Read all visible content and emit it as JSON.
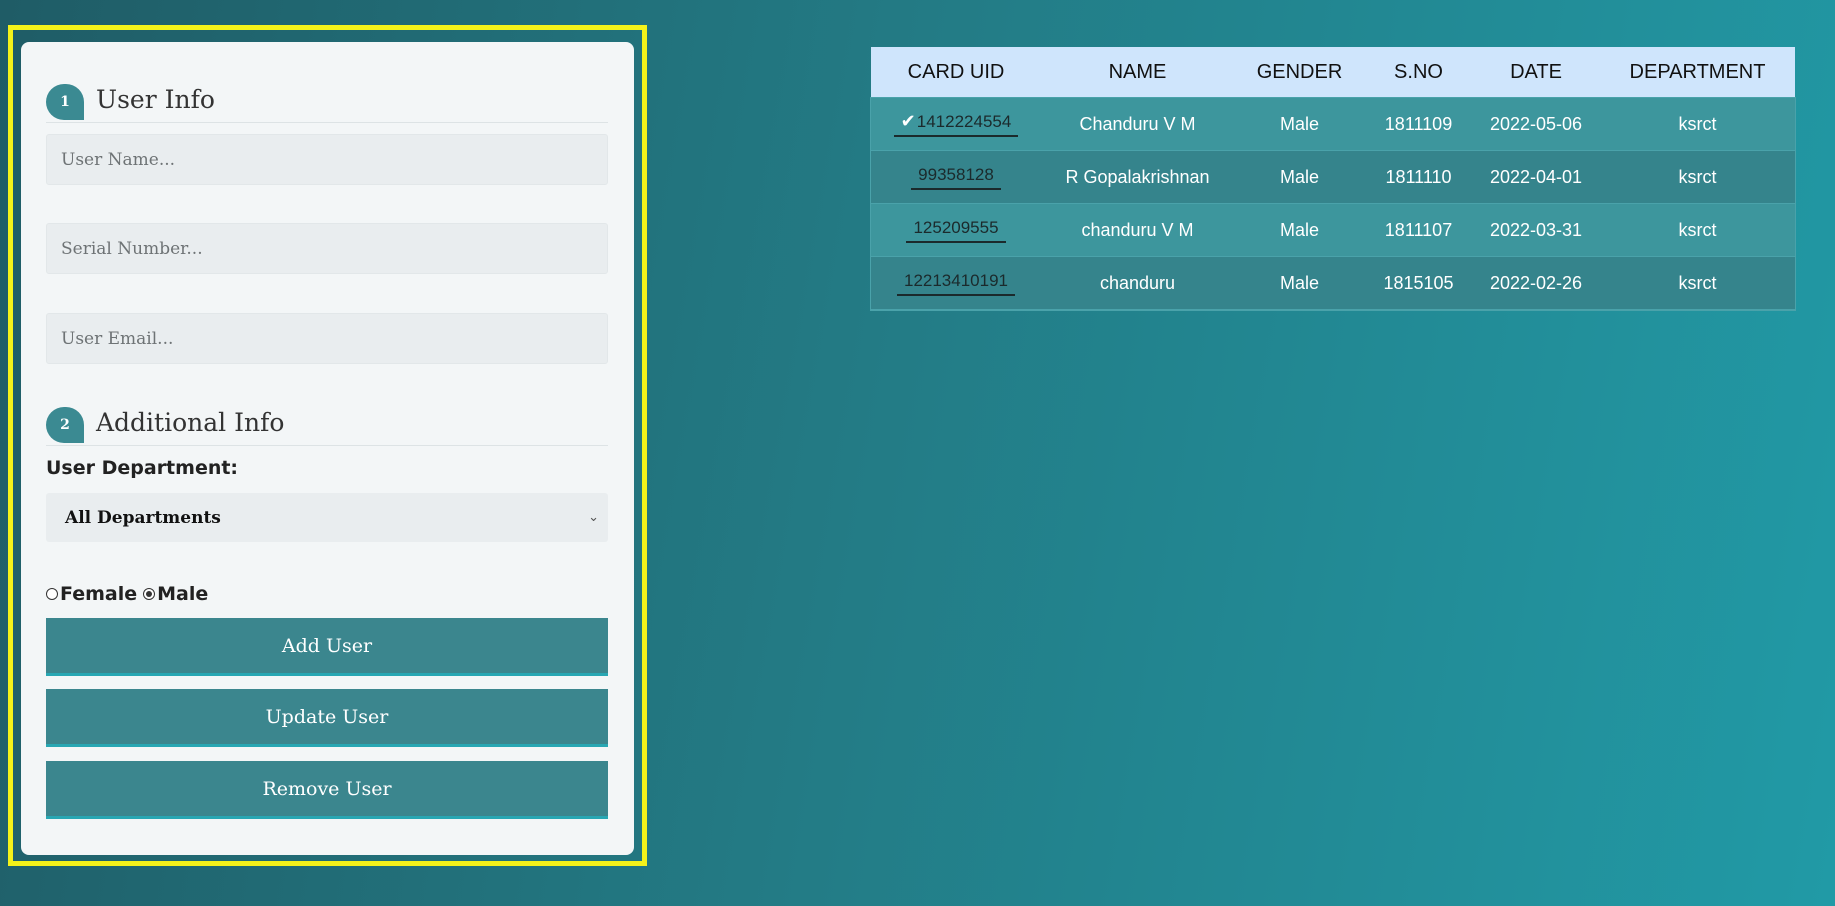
{
  "form": {
    "section1": {
      "step": "1",
      "title": "User Info"
    },
    "user_name": {
      "placeholder": "User Name..."
    },
    "serial_number": {
      "placeholder": "Serial Number..."
    },
    "user_email": {
      "placeholder": "User Email..."
    },
    "section2": {
      "step": "2",
      "title": "Additional Info"
    },
    "department_label": "User Department:",
    "department_selected": "All Departments",
    "gender_options": {
      "female": "Female",
      "male": "Male",
      "selected": "Male"
    },
    "buttons": {
      "add": "Add User",
      "update": "Update User",
      "remove": "Remove User"
    }
  },
  "table": {
    "headers": [
      "CARD UID",
      "NAME",
      "GENDER",
      "S.NO",
      "DATE",
      "DEPARTMENT"
    ],
    "rows": [
      {
        "card_uid": "1412224554",
        "name": "Chanduru V M",
        "gender": "Male",
        "sno": "1811109",
        "date": "2022-05-06",
        "department": "ksrct",
        "selected": true
      },
      {
        "card_uid": "99358128",
        "name": "R Gopalakrishnan",
        "gender": "Male",
        "sno": "1811110",
        "date": "2022-04-01",
        "department": "ksrct",
        "selected": false
      },
      {
        "card_uid": "125209555",
        "name": "chanduru V M",
        "gender": "Male",
        "sno": "1811107",
        "date": "2022-03-31",
        "department": "ksrct",
        "selected": false
      },
      {
        "card_uid": "12213410191",
        "name": "chanduru",
        "gender": "Male",
        "sno": "1815105",
        "date": "2022-02-26",
        "department": "ksrct",
        "selected": false
      }
    ]
  },
  "colors": {
    "highlight_border": "#f4f21a",
    "button_bg": "#3b868e",
    "table_header_bg": "#cfe5fc"
  },
  "icons": {
    "selected_row": "check-icon",
    "dropdown": "chevron-down-icon"
  }
}
